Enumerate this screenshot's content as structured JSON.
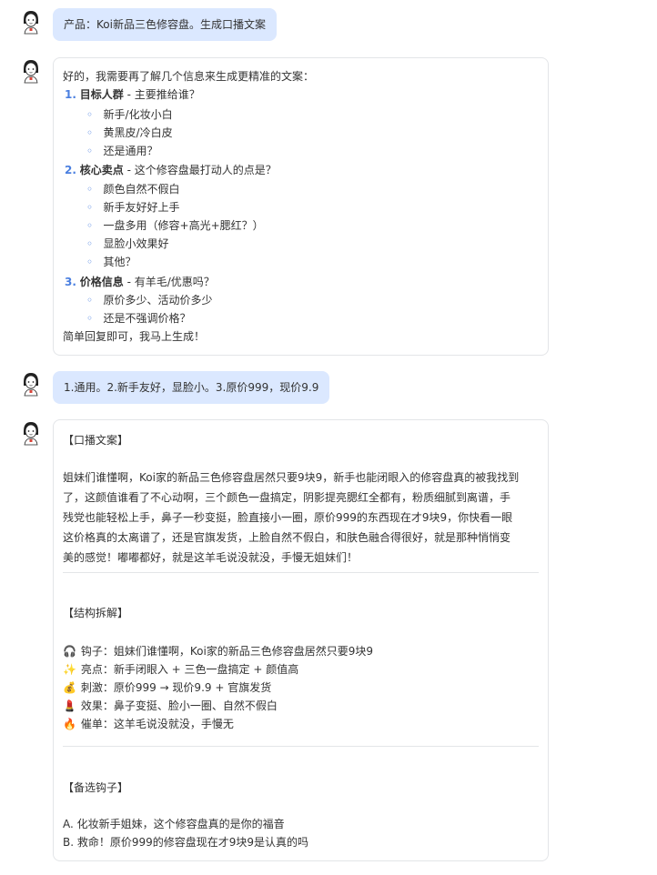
{
  "messages": {
    "m1": {
      "text": "产品：Koi新品三色修容盘。生成口播文案"
    },
    "m2": {
      "intro": "好的，我需要再了解几个信息来生成更精准的文案：",
      "q1": {
        "num": "1.",
        "title": "目标人群",
        "rest": " - 主要推给谁？",
        "opts": [
          "新手/化妆小白",
          "黄黑皮/冷白皮",
          "还是通用？"
        ]
      },
      "q2": {
        "num": "2.",
        "title": "核心卖点",
        "rest": " - 这个修容盘最打动人的点是？",
        "opts": [
          "颜色自然不假白",
          "新手友好好上手",
          "一盘多用（修容+高光+腮红？）",
          "显脸小效果好",
          "其他？"
        ]
      },
      "q3": {
        "num": "3.",
        "title": "价格信息",
        "rest": " - 有羊毛/优惠吗？",
        "opts": [
          "原价多少、活动价多少",
          "还是不强调价格？"
        ]
      },
      "outro": "简单回复即可，我马上生成！"
    },
    "m3": {
      "text": "1.通用。2.新手友好，显脸小。3.原价999，现价9.9"
    },
    "m4": {
      "h1": "【口播文案】",
      "body": [
        "姐妹们谁懂啊，Koi家的新品三色修容盘居然只要9块9，新手也能闭眼入的修容盘真的被我找到",
        "了，这颜值谁看了不心动啊，三个颜色一盘搞定，阴影提亮腮红全都有，粉质细腻到离谱，手",
        "残党也能轻松上手，鼻子一秒变挺，脸直接小一圈，原价999的东西现在才9块9，你快看一眼",
        "这价格真的太离谱了，还是官旗发货，上脸自然不假白，和肤色融合得很好，就是那种悄悄变",
        "美的感觉！嘟嘟都好，就是这羊毛说没就没，手慢无姐妹们！"
      ],
      "h2": "【结构拆解】",
      "struct": [
        {
          "icon": "🎧",
          "label": "钩子：",
          "text": "姐妹们谁懂啊，Koi家的新品三色修容盘居然只要9块9"
        },
        {
          "icon": "✨",
          "label": "亮点：",
          "text": "新手闭眼入 + 三色一盘搞定 + 颜值高"
        },
        {
          "icon": "💰",
          "label": "刺激：",
          "text": "原价999 → 现价9.9 + 官旗发货"
        },
        {
          "icon": "💄",
          "label": "效果：",
          "text": "鼻子变挺、脸小一圈、自然不假白"
        },
        {
          "icon": "🔥",
          "label": "催单：",
          "text": "这羊毛说没就没，手慢无"
        }
      ],
      "h3": "【备选钩子】",
      "alts": [
        "A. 化妆新手姐妹，这个修容盘真的是你的福音",
        "B. 救命！原价999的修容盘现在才9块9是认真的吗"
      ]
    }
  }
}
